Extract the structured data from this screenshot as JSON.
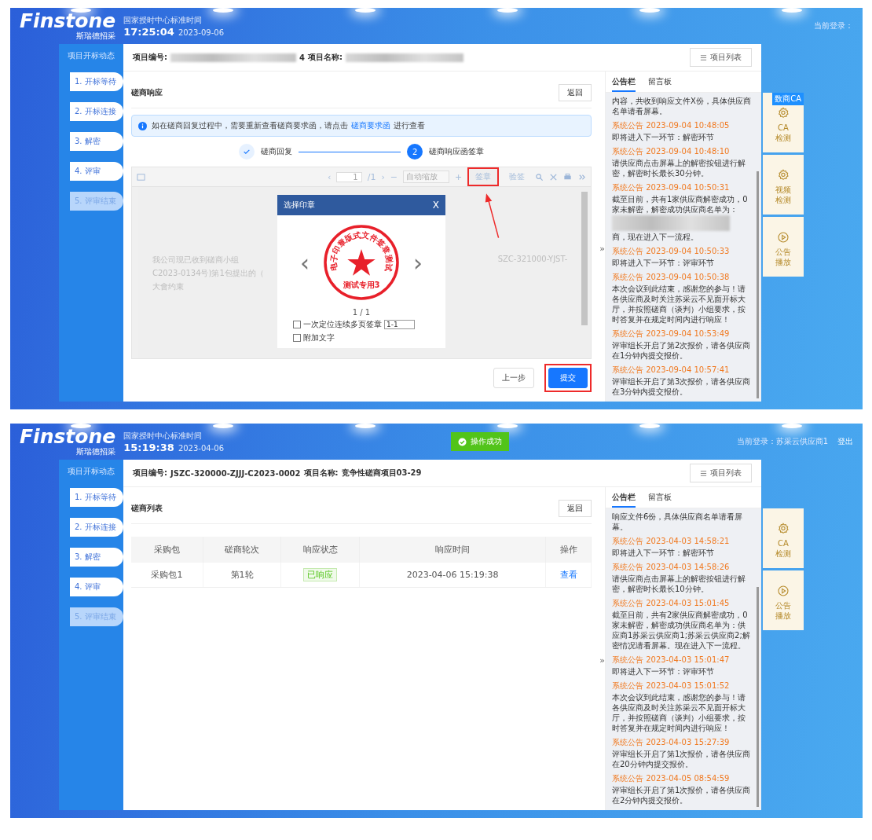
{
  "screens": [
    {
      "header": {
        "logo": "Finstone",
        "logo_sub": "斯瑞德招采",
        "clock_caption": "国家授时中心标准时间",
        "time": "17:25:04",
        "date": "2023-09-06",
        "login_text": "当前登录："
      },
      "sidebar": {
        "title": "项目开标动态",
        "steps": [
          {
            "label": "1. 开标等待",
            "disabled": false
          },
          {
            "label": "2. 开标连接",
            "disabled": false
          },
          {
            "label": "3. 解密",
            "disabled": false
          },
          {
            "label": "4. 评审",
            "disabled": false
          },
          {
            "label": "5. 评审结束",
            "disabled": true
          }
        ]
      },
      "project_bar": {
        "number_label": "项目编号:",
        "number_redacted": true,
        "number_tail": "4",
        "name_label": "项目名称:",
        "name_redacted": true,
        "list_button": "项目列表"
      },
      "main": {
        "kind": "response",
        "title": "磋商响应",
        "back_button": "返回",
        "banner": {
          "text": "如在磋商回复过程中，需要重新查看磋商要求函，请点击",
          "link": "磋商要求函",
          "after": "进行查看"
        },
        "progress": [
          {
            "label": "磋商回复",
            "completed": true
          },
          {
            "label": "磋商响应函签章",
            "number": "2",
            "completed": false
          }
        ],
        "viewer": {
          "prev_page": "‹",
          "next_page": "›",
          "zoom_out": "−",
          "zoom_in": "+",
          "page": "1",
          "page_total": "/1",
          "zoom": "自动缩放",
          "tools": [
            {
              "label": "签章",
              "highlighted": true
            },
            {
              "label": "验签",
              "highlighted": false
            }
          ],
          "doc_lines": [
            "我公司现已收到磋商小组",
            "C2023-0134号)第1包提出的（",
            "大會约束"
          ],
          "doc_right": "SZC-321000-YJST-"
        },
        "modal": {
          "title": "选择印章",
          "close": "X",
          "seal_arc": "电子印章版式文件签章测试",
          "seal_label": "测试专用3",
          "prev": "‹",
          "next": "›",
          "counter": "1 / 1",
          "options": [
            {
              "label": "一次定位连续多页签章",
              "checked": false,
              "value": "1-1"
            },
            {
              "label": "附加文字",
              "checked": false
            }
          ]
        },
        "buttons": [
          {
            "label": "上一步",
            "primary": false,
            "highlighted": false
          },
          {
            "label": "提交",
            "primary": true,
            "highlighted": true
          }
        ]
      },
      "collapse_glyph": "»",
      "notices": {
        "tabs": [
          {
            "label": "公告栏",
            "selected": true
          },
          {
            "label": "留言板",
            "selected": false
          }
        ],
        "lead": "内容，共收到响应文件X份，具体供应商名单请看屏幕。",
        "items": [
          {
            "title": "系统公告 2023-09-04 10:48:05",
            "body": "即将进入下一环节：解密环节"
          },
          {
            "title": "系统公告 2023-09-04 10:48:10",
            "body": "请供应商点击屏幕上的解密按钮进行解密，解密时长最长30分钟。"
          },
          {
            "title": "系统公告 2023-09-04 10:50:31",
            "body": "截至目前，共有1家供应商解密成功，0家未解密，解密成功供应商名单为：",
            "redacted": true,
            "tail": "商，现在进入下一流程。"
          },
          {
            "title": "系统公告 2023-09-04 10:50:33",
            "body": "即将进入下一环节：评审环节"
          },
          {
            "title": "系统公告 2023-09-04 10:50:38",
            "body": "本次会议到此结束，感谢您的参与！请各供应商及时关注苏采云不见面开标大厅，并按照磋商（谈判）小组要求，按时答复并在规定时间内进行响应！"
          },
          {
            "title": "系统公告 2023-09-04 10:53:49",
            "body": "评审组长开启了第2次报价，请各供应商在1分钟内提交报价。"
          },
          {
            "title": "系统公告 2023-09-04 10:57:41",
            "body": "评审组长开启了第3次报价，请各供应商在3分钟内提交报价。"
          }
        ]
      },
      "tools": [
        {
          "kind": "gear",
          "label": "CA 检测",
          "badge": "数商CA"
        },
        {
          "kind": "gear",
          "label": "视频检测"
        },
        {
          "kind": "play",
          "label": "公告播放"
        }
      ]
    },
    {
      "header": {
        "logo": "Finstone",
        "logo_sub": "斯瑞德招采",
        "clock_caption": "国家授时中心标准时间",
        "time": "15:19:38",
        "date": "2023-04-06",
        "login_text": "当前登录：苏采云供应商1",
        "toast": "操作成功",
        "logout": "登出"
      },
      "sidebar": {
        "title": "项目开标动态",
        "steps": [
          {
            "label": "1. 开标等待",
            "disabled": false
          },
          {
            "label": "2. 开标连接",
            "disabled": false
          },
          {
            "label": "3. 解密",
            "disabled": false
          },
          {
            "label": "4. 评审",
            "disabled": false
          },
          {
            "label": "5. 评审结束",
            "disabled": true
          }
        ]
      },
      "project_bar": {
        "number_label": "项目编号:",
        "number_redacted": false,
        "number_tail": "JSZC-320000-ZJJJ-C2023-0002",
        "name_label": "项目名称:",
        "name_value": "竞争性磋商项目03-29",
        "name_redacted": false,
        "list_button": "项目列表"
      },
      "main": {
        "kind": "list",
        "title": "磋商列表",
        "back_button": "返回",
        "table": {
          "columns": [
            "采购包",
            "磋商轮次",
            "响应状态",
            "响应时间",
            "操作"
          ],
          "rows": [
            {
              "package": "采购包1",
              "round": "第1轮",
              "status": "已响应",
              "time": "2023-04-06 15:19:38",
              "action": "查看"
            }
          ]
        }
      },
      "collapse_glyph": "»",
      "notices": {
        "tabs": [
          {
            "label": "公告栏",
            "selected": true
          },
          {
            "label": "留言板",
            "selected": false
          }
        ],
        "lead": "响应文件6份，具体供应商名单请看屏幕。",
        "items": [
          {
            "title": "系统公告 2023-04-03 14:58:21",
            "body": "即将进入下一环节：解密环节"
          },
          {
            "title": "系统公告 2023-04-03 14:58:26",
            "body": "请供应商点击屏幕上的解密按钮进行解密，解密时长最长10分钟。"
          },
          {
            "title": "系统公告 2023-04-03 15:01:45",
            "body": "截至目前，共有2家供应商解密成功，0家未解密，解密成功供应商名单为：供应商1苏采云供应商1;苏采云供应商2;解密情况请看屏幕。现在进入下一流程。"
          },
          {
            "title": "系统公告 2023-04-03 15:01:47",
            "body": "即将进入下一环节：评审环节"
          },
          {
            "title": "系统公告 2023-04-03 15:01:52",
            "body": "本次会议到此结束，感谢您的参与！请各供应商及时关注苏采云不见面开标大厅，并按照磋商（谈判）小组要求，按时答复并在规定时间内进行响应！"
          },
          {
            "title": "系统公告 2023-04-03 15:27:39",
            "body": "评审组长开启了第1次报价，请各供应商在20分钟内提交报价。"
          },
          {
            "title": "系统公告 2023-04-05 08:54:59",
            "body": "评审组长开启了第1次报价，请各供应商在2分钟内提交报价。"
          }
        ]
      },
      "tools": [
        {
          "kind": "gear",
          "label": "CA 检测"
        },
        {
          "kind": "play",
          "label": "公告播放"
        }
      ]
    }
  ]
}
